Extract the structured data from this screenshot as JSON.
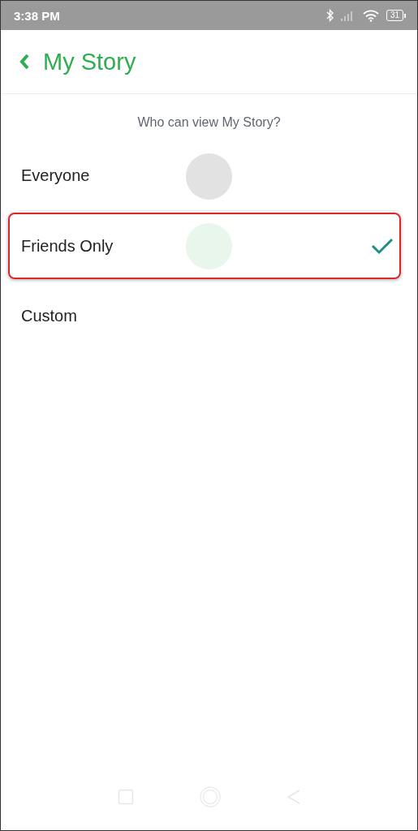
{
  "status_bar": {
    "time": "3:38 PM",
    "battery": "31"
  },
  "header": {
    "title": "My Story"
  },
  "question": "Who can view My Story?",
  "options": [
    {
      "label": "Everyone",
      "selected": false,
      "highlighted": false,
      "color": "#e2e2e2"
    },
    {
      "label": "Friends Only",
      "selected": true,
      "highlighted": true,
      "color": "#e8f6ec"
    },
    {
      "label": "Custom",
      "selected": false,
      "highlighted": false
    }
  ]
}
